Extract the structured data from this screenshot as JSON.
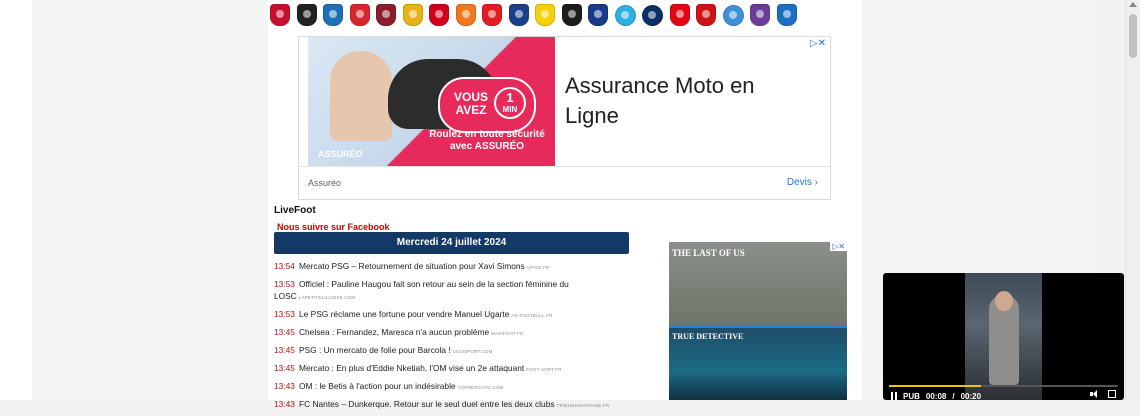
{
  "team_logos": [
    {
      "name": "ac-ajaccio",
      "color": "#c8102e"
    },
    {
      "name": "angers-sco",
      "color": "#222222"
    },
    {
      "name": "aj-auxerre",
      "color": "#1f6fb5"
    },
    {
      "name": "stade-brestois",
      "color": "#d7262e"
    },
    {
      "name": "clermont-foot",
      "color": "#8b1d2c"
    },
    {
      "name": "rc-lens",
      "color": "#e6b417"
    },
    {
      "name": "losc-lille",
      "color": "#d1001f"
    },
    {
      "name": "fc-lorient",
      "color": "#f07a1b"
    },
    {
      "name": "as-monaco",
      "color": "#e31b23"
    },
    {
      "name": "montpellier-hsc",
      "color": "#1d3e8a"
    },
    {
      "name": "fc-nantes",
      "color": "#f6d10a"
    },
    {
      "name": "ogc-nice",
      "color": "#1d1d1b"
    },
    {
      "name": "olympique-lyonnais",
      "color": "#1a3a8a"
    },
    {
      "name": "olympique-de-marseille",
      "color": "#2faee0"
    },
    {
      "name": "paris-saint-germain",
      "color": "#0b2f67"
    },
    {
      "name": "stade-de-reims",
      "color": "#e30613"
    },
    {
      "name": "stade-rennais",
      "color": "#d11218"
    },
    {
      "name": "rc-strasbourg",
      "color": "#3f90d6"
    },
    {
      "name": "toulouse-fc",
      "color": "#6b3d99"
    },
    {
      "name": "estac-troyes",
      "color": "#1b6fc2"
    }
  ],
  "ad_top": {
    "choices_icon": "ad-choices-icon",
    "bubble_text": "VOUS AVEZ",
    "bubble_number": "1",
    "bubble_unit": "MIN",
    "tagline": "Roulez en toute sécurité avec ASSURÉO",
    "brandmark": "ASSURÉO",
    "headline": "Assurance Moto en Ligne",
    "advertiser": "Assuréo",
    "cta": "Devis",
    "accent_color": "#e72a5c"
  },
  "livefoot": {
    "title": "LiveFoot",
    "facebook_link": "Nous suivre sur Facebook",
    "date_header": "Mercredi 24 juillet 2024",
    "header_color": "#133a67",
    "items": [
      {
        "time": "13:54",
        "title": "Mercato PSG – Retournement de situation pour Xavi Simons",
        "source": "VIPSG.FR"
      },
      {
        "time": "13:53",
        "title": "Officiel : Pauline Haugou fait son retour au sein de la section féminine du LOSC",
        "source": "LAPETITELILLOISE.COM"
      },
      {
        "time": "13:53",
        "title": "Le PSG réclame une fortune pour vendre Manuel Ugarte",
        "source": "AS-FOOTBALL.FR"
      },
      {
        "time": "13:45",
        "title": "Chelsea : Fernandez, Maresca n'a aucun problème",
        "source": "MAXIFOOT.FR"
      },
      {
        "time": "13:45",
        "title": "PSG : Un mercato de folie pour Barcola !",
        "source": "LE10SPORT.COM"
      },
      {
        "time": "13:45",
        "title": "Mercato : En plus d'Eddie Nketiah, l'OM vise un 2e attaquant",
        "source": "FOOT-SORT.FR"
      },
      {
        "time": "13:43",
        "title": "OM : le Betis à l'action pour un indésirable",
        "source": "TOPMERCATO.COM"
      },
      {
        "time": "13:43",
        "title": "FC Nantes – Dunkerque. Retour sur le seul duel entre les deux clubs",
        "source": "TRIBUNENANTAISE.FR"
      }
    ]
  },
  "ad_right": {
    "title1": "THE LAST OF US",
    "title2": "TRUE DETECTIVE"
  },
  "video": {
    "label": "PUB",
    "current_time": "00:08",
    "separator": "/",
    "duration": "00:20",
    "progress": 0.4,
    "progress_color": "#f2c100"
  }
}
